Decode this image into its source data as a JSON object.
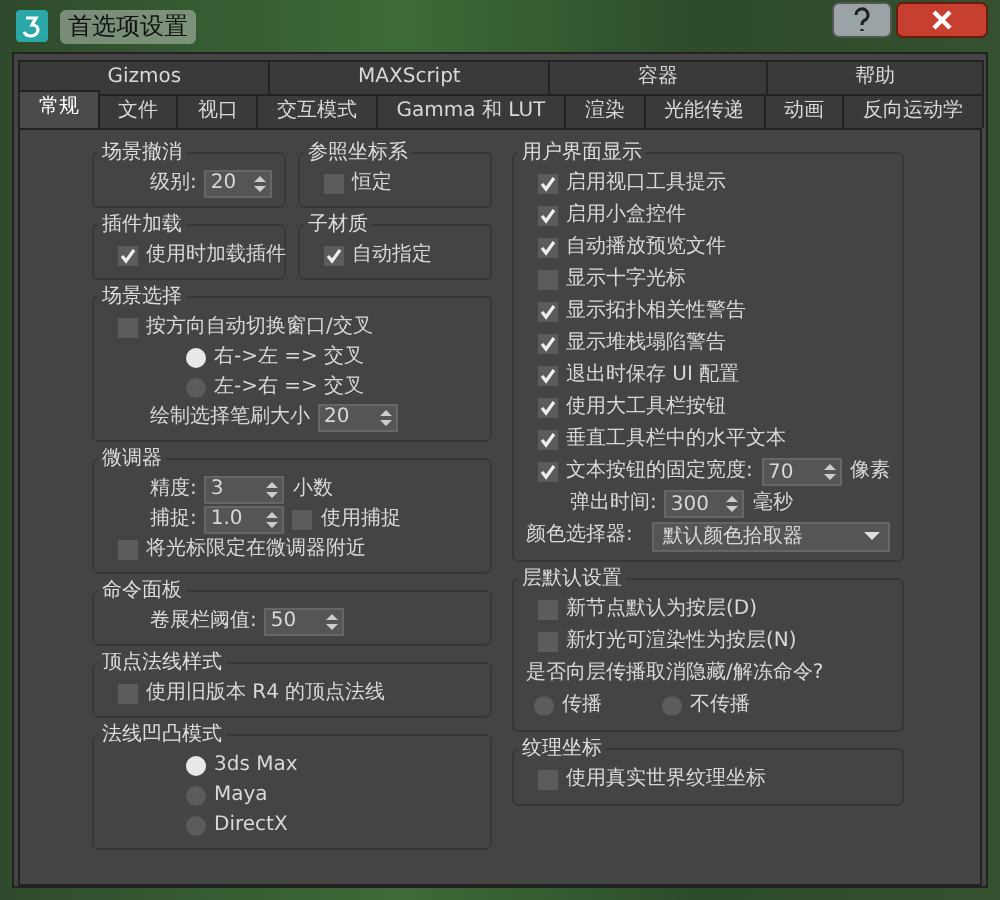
{
  "window": {
    "title": "首选项设置"
  },
  "tab_rows": [
    [
      {
        "label": "Gizmos",
        "selected": false
      },
      {
        "label": "MAXScript",
        "selected": false
      },
      {
        "label": "容器",
        "selected": false
      },
      {
        "label": "帮助",
        "selected": false
      }
    ],
    [
      {
        "label": "常规",
        "selected": true
      },
      {
        "label": "文件",
        "selected": false
      },
      {
        "label": "视口",
        "selected": false
      },
      {
        "label": "交互模式",
        "selected": false
      },
      {
        "label": "Gamma 和 LUT",
        "selected": false
      },
      {
        "label": "渲染",
        "selected": false
      },
      {
        "label": "光能传递",
        "selected": false
      },
      {
        "label": "动画",
        "selected": false
      },
      {
        "label": "反向运动学",
        "selected": false
      }
    ]
  ],
  "left_column": [
    [
      {
        "title": "场景撤消",
        "items": [
          {
            "kind": "spinner",
            "label": "级别:",
            "value": "20"
          }
        ]
      },
      {
        "title": "参照坐标系",
        "items": [
          {
            "kind": "checkbox",
            "label": "恒定",
            "checked": false
          }
        ]
      }
    ],
    [
      {
        "title": "插件加载",
        "items": [
          {
            "kind": "checkbox",
            "label": "使用时加载插件",
            "checked": true
          }
        ]
      },
      {
        "title": "子材质",
        "items": [
          {
            "kind": "checkbox",
            "label": "自动指定",
            "checked": true
          }
        ]
      }
    ],
    [
      {
        "title": "场景选择",
        "items": [
          {
            "kind": "checkbox",
            "label": "按方向自动切换窗口/交叉",
            "checked": false
          },
          {
            "kind": "radio",
            "label": "右->左 => 交叉",
            "selected": true
          },
          {
            "kind": "radio",
            "label": "左->右 => 交叉",
            "selected": false
          },
          {
            "kind": "spinner",
            "label": "绘制选择笔刷大小",
            "value": "20"
          }
        ]
      }
    ],
    [
      {
        "title": "微调器",
        "items": [
          {
            "kind": "spinner",
            "label": "精度:",
            "value": "3",
            "unit": "小数"
          },
          {
            "kind": "spinner_check",
            "label": "捕捉:",
            "value": "1.0",
            "check": {
              "label": "使用捕捉",
              "checked": false
            }
          },
          {
            "kind": "checkbox",
            "label": "将光标限定在微调器附近",
            "checked": false
          }
        ]
      }
    ],
    [
      {
        "title": "命令面板",
        "items": [
          {
            "kind": "spinner",
            "label": "卷展栏阈值:",
            "value": "50"
          }
        ]
      }
    ],
    [
      {
        "title": "顶点法线样式",
        "items": [
          {
            "kind": "checkbox",
            "label": "使用旧版本 R4 的顶点法线",
            "checked": false
          }
        ]
      }
    ],
    [
      {
        "title": "法线凹凸模式",
        "items": [
          {
            "kind": "radio",
            "label": "3ds Max",
            "selected": true
          },
          {
            "kind": "radio",
            "label": "Maya",
            "selected": false
          },
          {
            "kind": "radio",
            "label": "DirectX",
            "selected": false
          }
        ]
      }
    ]
  ],
  "right_column": [
    {
      "title": "用户界面显示",
      "items": [
        {
          "kind": "checkbox",
          "label": "启用视口工具提示",
          "checked": true
        },
        {
          "kind": "checkbox",
          "label": "启用小盒控件",
          "checked": true
        },
        {
          "kind": "checkbox",
          "label": "自动播放预览文件",
          "checked": true
        },
        {
          "kind": "checkbox",
          "label": "显示十字光标",
          "checked": false
        },
        {
          "kind": "checkbox",
          "label": "显示拓扑相关性警告",
          "checked": true
        },
        {
          "kind": "checkbox",
          "label": "显示堆栈塌陷警告",
          "checked": true
        },
        {
          "kind": "checkbox",
          "label": "退出时保存 UI 配置",
          "checked": true
        },
        {
          "kind": "checkbox",
          "label": "使用大工具栏按钮",
          "checked": true
        },
        {
          "kind": "checkbox",
          "label": "垂直工具栏中的水平文本",
          "checked": true
        },
        {
          "kind": "check_spinner",
          "label": "文本按钮的固定宽度:",
          "checked": true,
          "value": "70",
          "unit": "像素"
        },
        {
          "kind": "spinner",
          "label": "弹出时间:",
          "value": "300",
          "unit": "毫秒"
        },
        {
          "kind": "dropdown",
          "label": "颜色选择器:",
          "value": "默认颜色拾取器"
        }
      ]
    },
    {
      "title": "层默认设置",
      "items": [
        {
          "kind": "checkbox",
          "label": "新节点默认为按层(D)",
          "checked": false
        },
        {
          "kind": "checkbox",
          "label": "新灯光可渲染性为按层(N)",
          "checked": false
        },
        {
          "kind": "text",
          "label": "是否向层传播取消隐藏/解冻命令?"
        },
        {
          "kind": "radio_row",
          "options": [
            {
              "label": "传播",
              "selected": false
            },
            {
              "label": "不传播",
              "selected": false
            }
          ]
        }
      ]
    },
    {
      "title": "纹理坐标",
      "items": [
        {
          "kind": "checkbox",
          "label": "使用真实世界纹理坐标",
          "checked": false
        }
      ]
    }
  ]
}
